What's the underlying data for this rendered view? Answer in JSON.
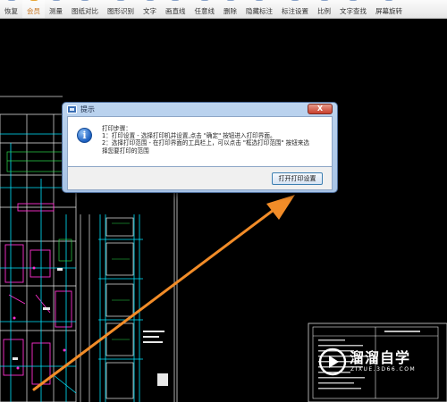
{
  "toolbar": {
    "items": [
      {
        "label": "恢复"
      },
      {
        "label": "会员"
      },
      {
        "label": "测量"
      },
      {
        "label": "图纸对比"
      },
      {
        "label": "图形识别"
      },
      {
        "label": "文字"
      },
      {
        "label": "画直线"
      },
      {
        "label": "任意线"
      },
      {
        "label": "删除"
      },
      {
        "label": "隐藏标注"
      },
      {
        "label": "标注设置"
      },
      {
        "label": "比例"
      },
      {
        "label": "文字查找"
      },
      {
        "label": "屏幕旋转"
      }
    ]
  },
  "dialog": {
    "title": "提示",
    "close_label": "X",
    "message_lines": [
      "打印步骤：",
      "1：打印设置 - 选择打印机并设置,点击 \"确定\" 按钮进入打印界面。",
      "2：选择打印范围 - 在打印界面的工具栏上，可以点击 \"框选打印范围\" 按钮来选",
      "择您要打印的范围"
    ],
    "button_label": "打开打印设置"
  },
  "watermark": {
    "title": "溜溜自学",
    "subtitle": "ZIXUE.3D66.COM"
  },
  "colors": {
    "accent": "#e8a637",
    "arrow": "#f28c28",
    "cad_cyan": "#00e5ff",
    "cad_magenta": "#ff2fd0",
    "cad_green": "#2bd64a",
    "cad_white": "#e8e8e8"
  }
}
